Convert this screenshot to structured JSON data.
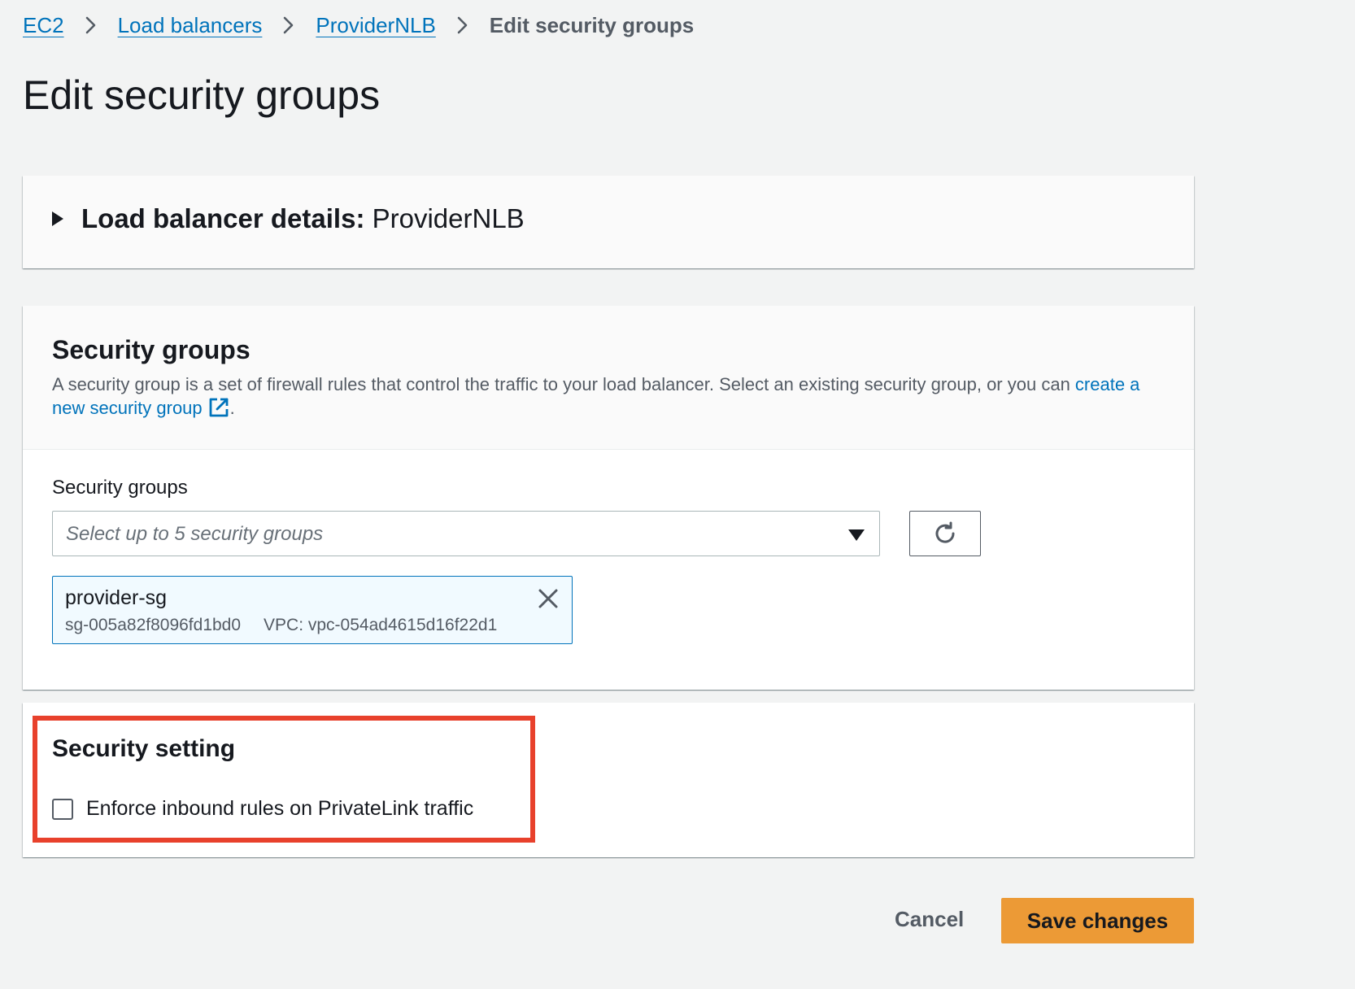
{
  "breadcrumb": {
    "items": [
      {
        "label": "EC2"
      },
      {
        "label": "Load balancers"
      },
      {
        "label": "ProviderNLB"
      }
    ],
    "current": "Edit security groups"
  },
  "page": {
    "title": "Edit security groups"
  },
  "details": {
    "label": "Load balancer details:",
    "value": "ProviderNLB",
    "expanded": false
  },
  "security_groups": {
    "heading": "Security groups",
    "description": "A security group is a set of firewall rules that control the traffic to your load balancer. Select an existing security group, or you can ",
    "create_link": "create a new security group",
    "description_end": ".",
    "field_label": "Security groups",
    "select_placeholder": "Select up to 5 security groups",
    "selected": [
      {
        "name": "provider-sg",
        "id": "sg-005a82f8096fd1bd0",
        "vpc": "VPC: vpc-054ad4615d16f22d1"
      }
    ]
  },
  "security_setting": {
    "heading": "Security setting",
    "checkbox_label": "Enforce inbound rules on PrivateLink traffic",
    "checked": false
  },
  "actions": {
    "cancel": "Cancel",
    "save": "Save changes"
  },
  "icons": {
    "breadcrumb_separator": "chevron-right-icon",
    "details_toggle": "caret-right-icon",
    "create_link": "external-link-icon",
    "dropdown": "caret-down-icon",
    "refresh": "refresh-icon",
    "token_remove": "close-icon"
  },
  "colors": {
    "link": "#0073bb",
    "primary_button": "#ec9a36",
    "highlight_annotation": "#e8412c",
    "token_background": "#f1faff",
    "page_background": "#f2f3f3"
  }
}
